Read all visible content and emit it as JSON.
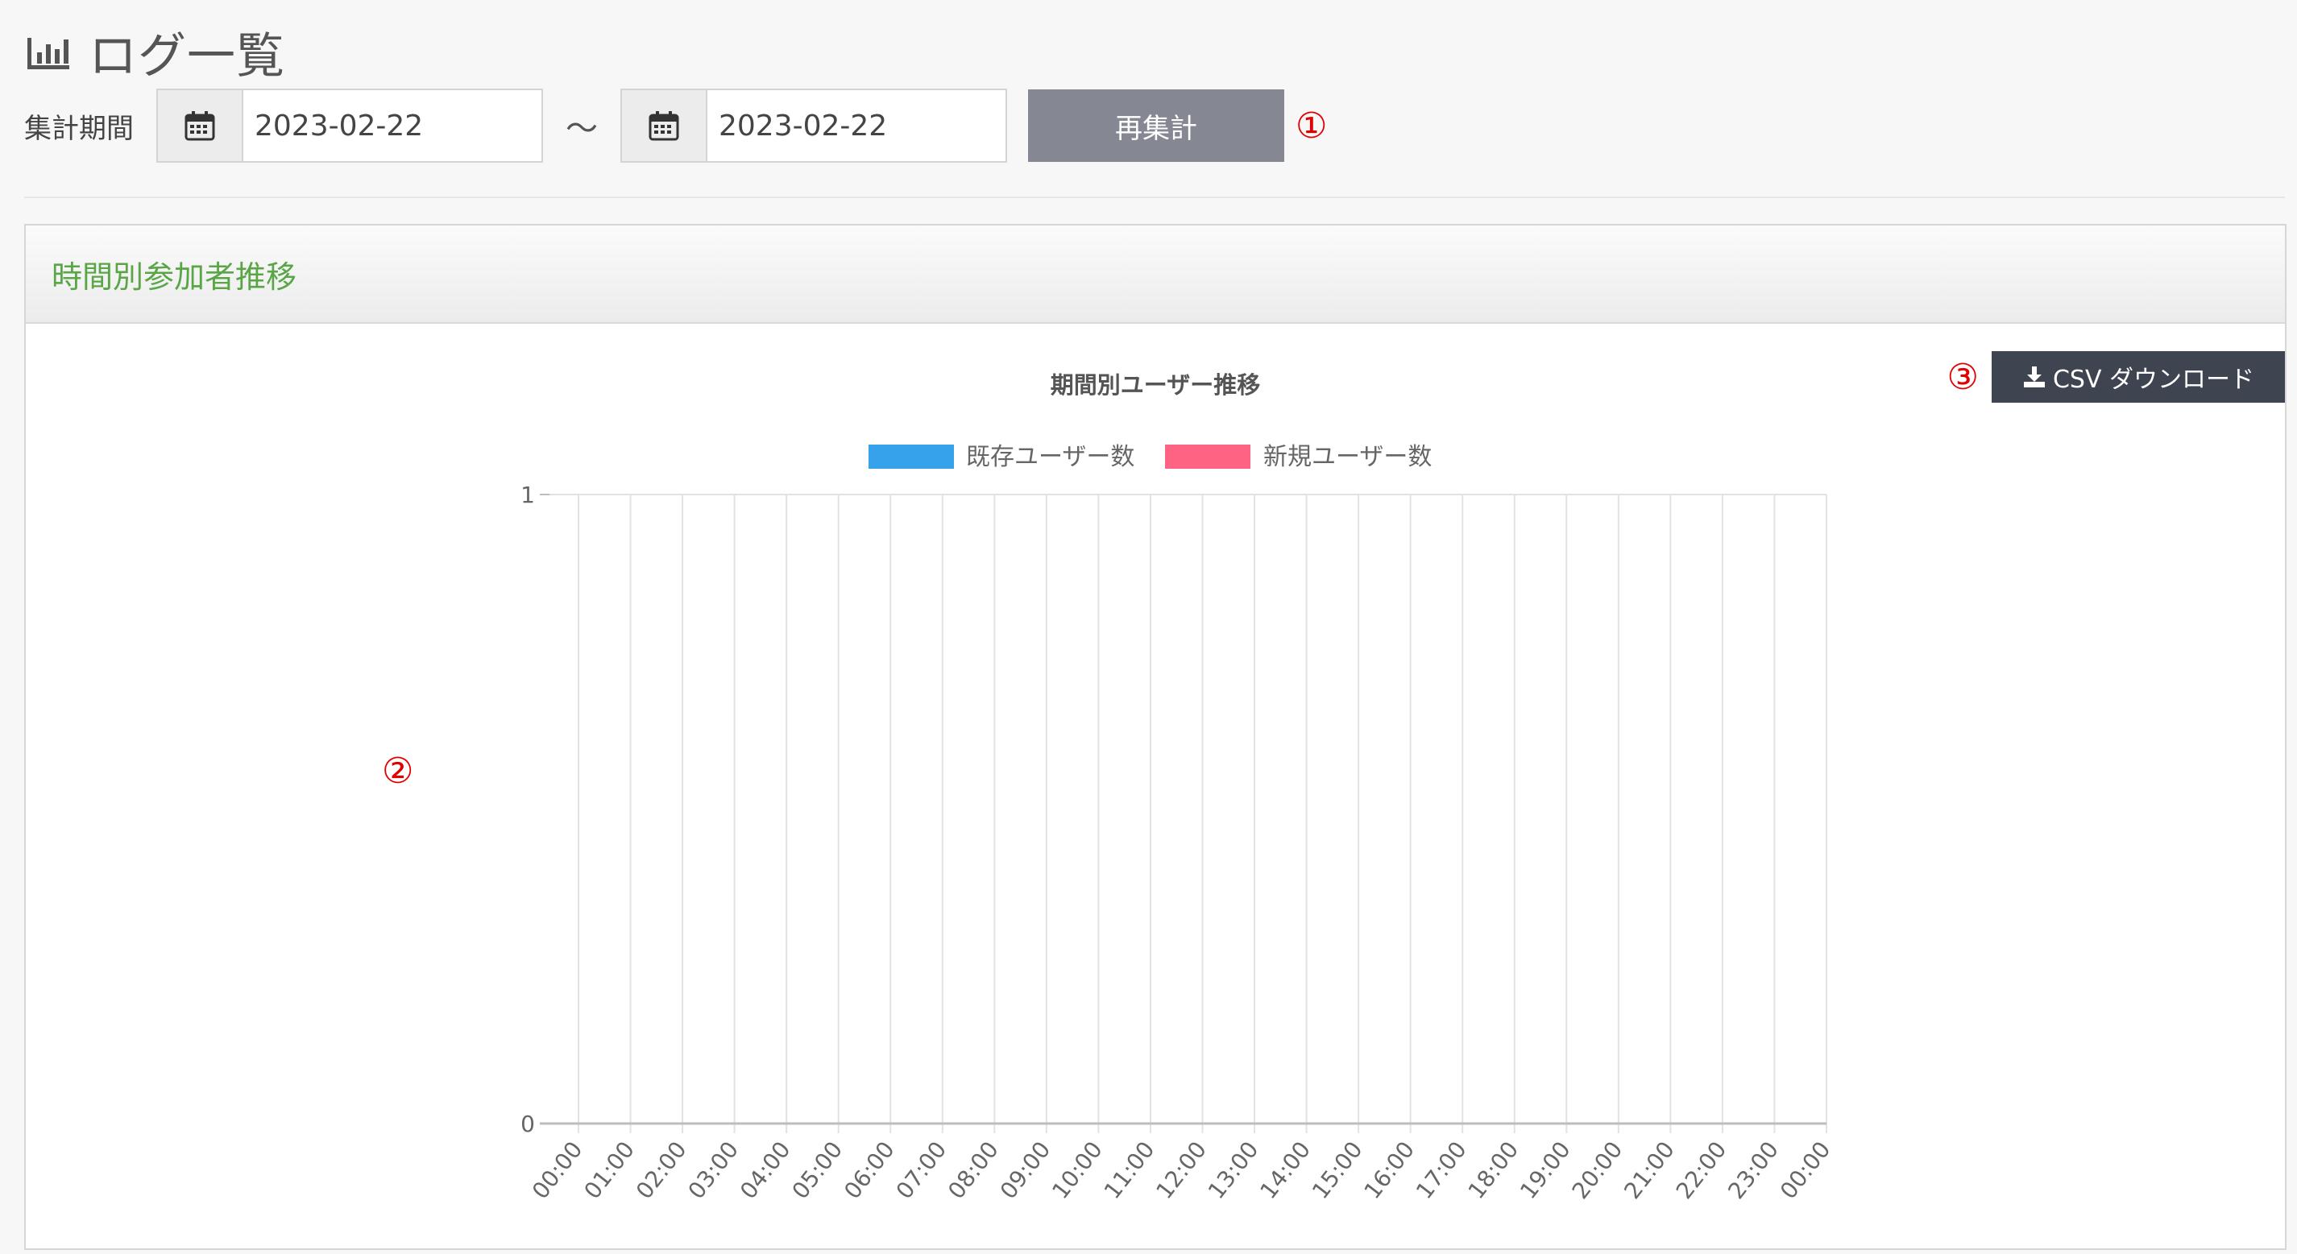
{
  "header": {
    "title": "ログ一覧"
  },
  "filter": {
    "label": "集計期間",
    "start_date": "2023-02-22",
    "separator": "〜",
    "end_date": "2023-02-22",
    "recalc_label": "再集計"
  },
  "markers": {
    "m1": "①",
    "m2": "②",
    "m3": "③"
  },
  "panel": {
    "title": "時間別参加者推移",
    "csv_label": "CSV ダウンロード"
  },
  "colors": {
    "existing_users": "#36a2eb",
    "new_users": "#ff6384",
    "panel_title": "#5aa546"
  },
  "chart_data": {
    "type": "bar",
    "title": "期間別ユーザー推移",
    "categories": [
      "00:00",
      "01:00",
      "02:00",
      "03:00",
      "04:00",
      "05:00",
      "06:00",
      "07:00",
      "08:00",
      "09:00",
      "10:00",
      "11:00",
      "12:00",
      "13:00",
      "14:00",
      "15:00",
      "16:00",
      "17:00",
      "18:00",
      "19:00",
      "20:00",
      "21:00",
      "22:00",
      "23:00",
      "00:00"
    ],
    "series": [
      {
        "name": "既存ユーザー数",
        "color": "#36a2eb",
        "values": [
          0,
          0,
          0,
          0,
          0,
          0,
          0,
          0,
          0,
          0,
          0,
          0,
          0,
          0,
          0,
          0,
          0,
          0,
          0,
          0,
          0,
          0,
          0,
          0,
          0
        ]
      },
      {
        "name": "新規ユーザー数",
        "color": "#ff6384",
        "values": [
          0,
          0,
          0,
          0,
          0,
          0,
          0,
          0,
          0,
          0,
          0,
          0,
          0,
          0,
          0,
          0,
          0,
          0,
          0,
          0,
          0,
          0,
          0,
          0,
          0
        ]
      }
    ],
    "ylim": [
      0,
      1
    ],
    "yticks": [
      "0",
      "1"
    ],
    "legend": "top",
    "grid": true
  }
}
